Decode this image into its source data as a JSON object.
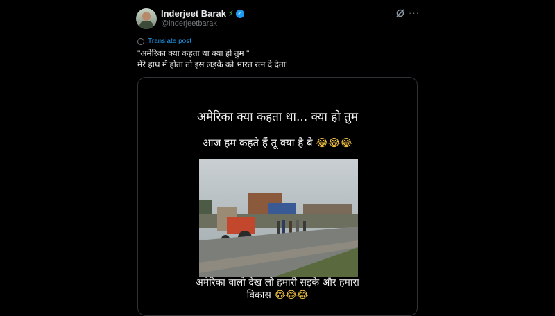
{
  "tweet": {
    "author_name": "Inderjeet Barak",
    "name_emoji": "⚡",
    "verified_mark": "✓",
    "handle": "@inderjeetbarak",
    "translate_label": "Translate post",
    "more_icon": "···",
    "text_line1": "\"अमेरिका क्या कहता था क्या हो तुम \"",
    "text_line2": "मेरे हाथ में होता तो इस लड़के को भारत रत्न दे देता!"
  },
  "media": {
    "caption_top": "अमेरिका क्या कहता था... क्या हो तुम",
    "caption_second": "आज हम कहते हैं तू क्या है बे",
    "caption_second_emojis": "😂😂😂",
    "caption_bottom_line1": "अमेरिका वालो देख लो हमारी सड़के और हमारा",
    "caption_bottom_line2": "विकास",
    "caption_bottom_emojis": "😂😂😂"
  }
}
